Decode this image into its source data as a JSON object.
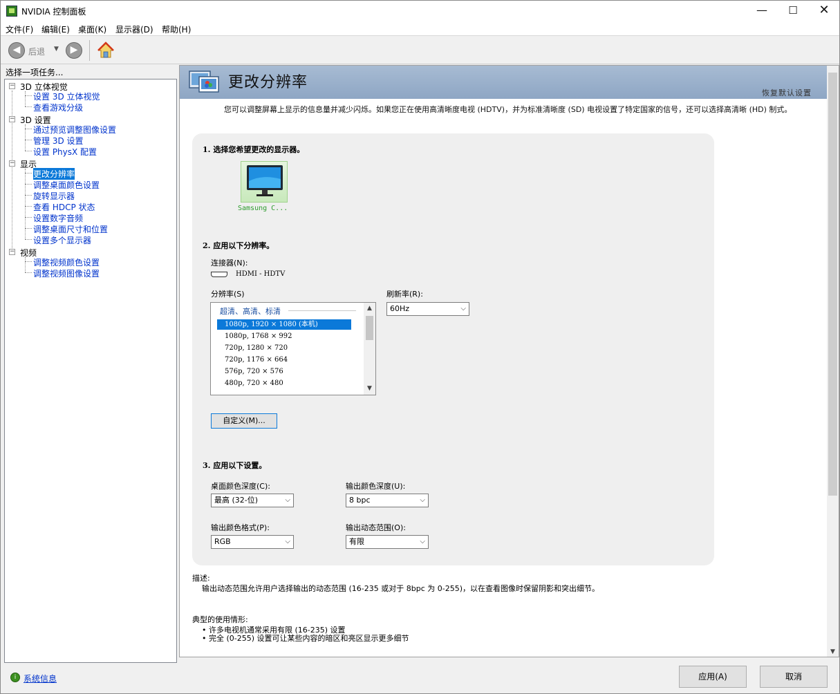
{
  "window": {
    "title": "NVIDIA 控制面板",
    "minimize": "—",
    "maximize": "☐",
    "close": "✕"
  },
  "menu": [
    "文件(F)",
    "编辑(E)",
    "桌面(K)",
    "显示器(D)",
    "帮助(H)"
  ],
  "toolbar": {
    "back_label": "后退",
    "back_icon": "◀",
    "forward_icon": "▶",
    "dropdown": "▼"
  },
  "sidebar": {
    "task_label": "选择一项任务...",
    "categories": [
      {
        "label": "3D 立体视觉",
        "items": [
          "设置 3D 立体视觉",
          "查看游戏分级"
        ]
      },
      {
        "label": "3D 设置",
        "items": [
          "通过预览调整图像设置",
          "管理 3D 设置",
          "设置 PhysX 配置"
        ]
      },
      {
        "label": "显示",
        "items": [
          "更改分辨率",
          "调整桌面颜色设置",
          "旋转显示器",
          "查看 HDCP 状态",
          "设置数字音频",
          "调整桌面尺寸和位置",
          "设置多个显示器"
        ]
      },
      {
        "label": "视频",
        "items": [
          "调整视频颜色设置",
          "调整视频图像设置"
        ]
      }
    ],
    "selected": "更改分辨率",
    "expander": "−",
    "system_info": "系统信息"
  },
  "page": {
    "title": "更改分辨率",
    "restore_defaults": "恢复默认设置",
    "intro": "您可以调整屏幕上显示的信息量并减少闪烁。如果您正在使用高清晰度电视 (HDTV)，并为标准清晰度 (SD) 电视设置了特定国家的信号，还可以选择高清晰 (HD) 制式。",
    "section1": {
      "title": "1. 选择您希望更改的显示器。",
      "display_name": "Samsung C..."
    },
    "section2": {
      "title": "2. 应用以下分辨率。",
      "connector_label": "连接器(N):",
      "connector_value": "HDMI - HDTV",
      "resolution_label": "分辨率(S)",
      "group_label": "超清、高清、标清",
      "resolutions": [
        "1080p, 1920 × 1080 (本机)",
        "1080p, 1768 × 992",
        "720p, 1280 × 720",
        "720p, 1176 × 664",
        "576p, 720 × 576",
        "480p, 720 × 480"
      ],
      "selected_resolution": "1080p, 1920 × 1080 (本机)",
      "refresh_label": "刷新率(R):",
      "refresh_value": "60Hz",
      "custom_button": "自定义(M)..."
    },
    "section3": {
      "title": "3. 应用以下设置。",
      "desktop_depth_label": "桌面颜色深度(C):",
      "desktop_depth_value": "最高 (32-位)",
      "output_depth_label": "输出颜色深度(U):",
      "output_depth_value": "8 bpc",
      "output_format_label": "输出颜色格式(P):",
      "output_format_value": "RGB",
      "output_range_label": "输出动态范围(O):",
      "output_range_value": "有限"
    },
    "description": {
      "title": "描述:",
      "text": "输出动态范围允许用户选择输出的动态范围 (16-235 或对于 8bpc 为 0-255)，以在查看图像时保留阴影和突出细节。"
    },
    "usage": {
      "title": "典型的使用情形:",
      "items": [
        "• 许多电视机通常采用有限 (16-235) 设置",
        "• 完全 (0-255) 设置可让某些内容的暗区和亮区显示更多细节"
      ]
    }
  },
  "buttons": {
    "apply": "应用(A)",
    "cancel": "取消"
  },
  "colors": {
    "selection": "#0b79d9",
    "link": "#0033cc",
    "banner": "#9db2cd",
    "display_name": "#2d9c2d"
  }
}
